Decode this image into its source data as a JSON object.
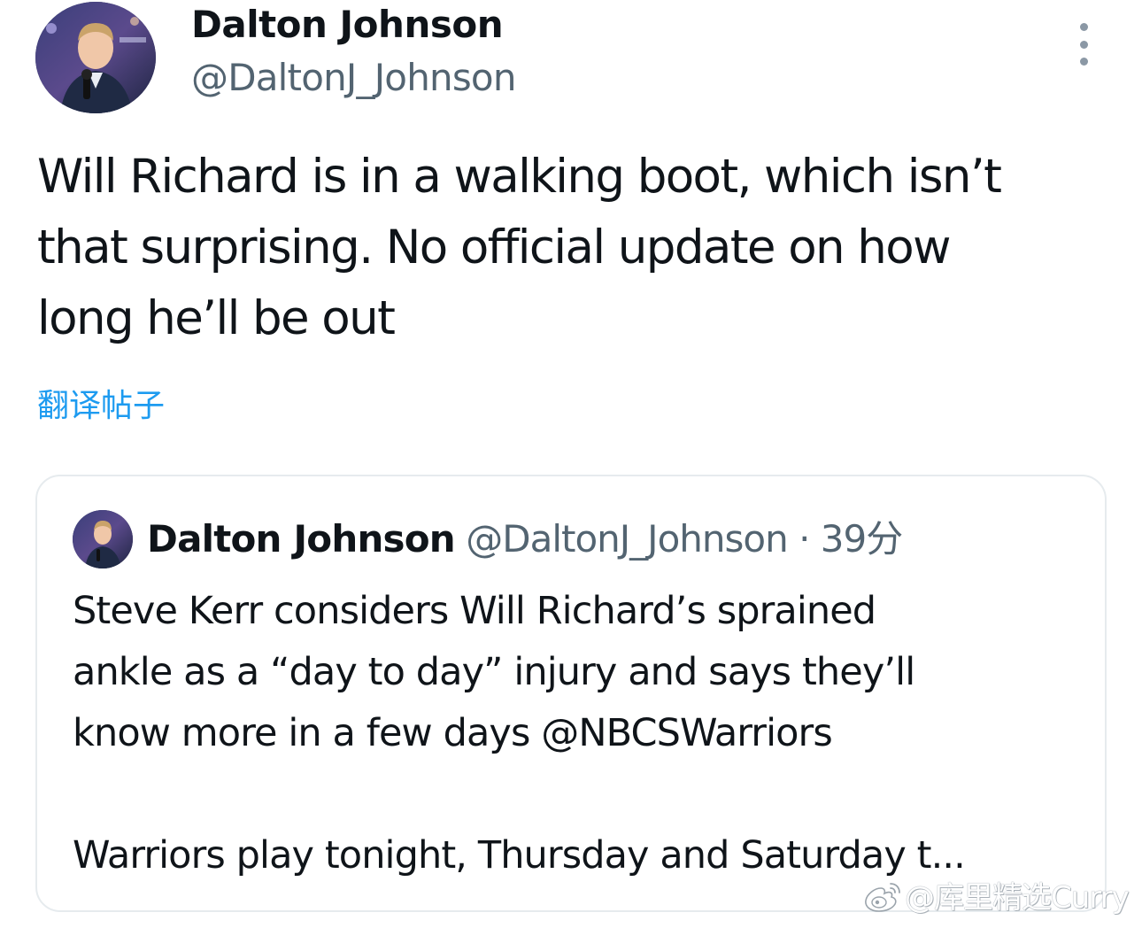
{
  "tweet": {
    "author": {
      "display_name": "Dalton Johnson",
      "handle": "@DaltonJ_Johnson"
    },
    "more_icon": "more-vertical-icon",
    "text": "Will Richard is in a walking boot, which isn’t\nthat surprising. No official update on how\nlong he’ll be out",
    "translate_label": "翻译帖子"
  },
  "quoted_tweet": {
    "author": {
      "display_name": "Dalton Johnson",
      "handle": "@DaltonJ_Johnson"
    },
    "separator": "·",
    "time": "39分",
    "text": "Steve Kerr considers Will Richard’s sprained\nankle as a “day to day” injury and says they’ll\nknow more in a few days @NBCSWarriors\n\nWarriors play tonight, Thursday and Saturday t..."
  },
  "watermark": {
    "icon": "weibo-icon",
    "text": "@库里精选Curry"
  },
  "colors": {
    "text_primary": "#0f1419",
    "text_secondary": "#536471",
    "link": "#1d9bf0",
    "border": "#e6ebee"
  }
}
